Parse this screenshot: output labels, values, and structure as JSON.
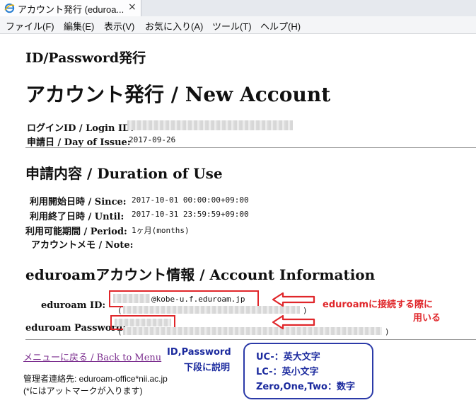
{
  "tab": {
    "title": "アカウント発行 (eduroa...",
    "close": "×"
  },
  "menu": [
    {
      "label": "ファイル(F)"
    },
    {
      "label": "編集(E)"
    },
    {
      "label": "表示(V)"
    },
    {
      "label": "お気に入り(A)"
    },
    {
      "label": "ツール(T)"
    },
    {
      "label": "ヘルプ(H)"
    }
  ],
  "page": {
    "subtitle": "ID/Password発行",
    "title": "アカウント発行 / New Account",
    "login_id_label": "ログインID / Login ID:",
    "issue_label": "申請日 / Day of Issue:",
    "issue_value": "2017-09-26",
    "duration_heading": "申請内容 / Duration of Use",
    "since_label": "利用開始日時 / Since:",
    "since_value": "2017-10-01 00:00:00+09:00",
    "until_label": "利用終了日時 / Until:",
    "until_value": "2017-10-31 23:59:59+09:00",
    "period_label": "利用可能期間 / Period:",
    "period_value": "1ヶ月(months)",
    "note_label": "アカウントメモ / Note:",
    "account_heading": "eduroamアカウント情報 / Account Information",
    "eduroam_id_label": "eduroam ID:",
    "eduroam_id_value": "@kobe-u.f.eduroam.jp",
    "paren_open": "(",
    "paren_close": ")",
    "eduroam_pw_label": "eduroam Password:",
    "back_link": "メニューに戻る / Back to Menu",
    "contact_line1": "管理者連絡先: eduroam-office*nii.ac.jp",
    "contact_line2": "(*にはアットマークが入ります)"
  },
  "annotations": {
    "connect_line1": "eduroamに接続する際に",
    "connect_line2": "用いる",
    "note_line1": "ID,Password",
    "note_line2": "下段に説明",
    "legend": [
      "UC-：英大文字",
      "LC-：英小文字",
      "Zero,One,Two：数字"
    ],
    "red": "#e0262a",
    "blue": "#1b2a9e"
  }
}
